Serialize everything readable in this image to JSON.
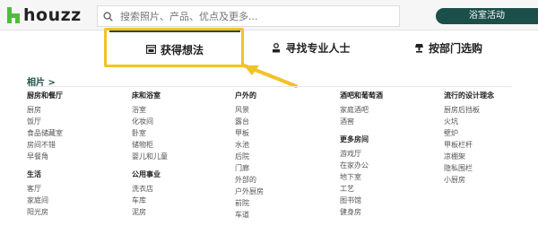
{
  "header": {
    "logo_text": "houzz",
    "search_placeholder": "搜索照片、产品、优点及更多...",
    "cta_label": "浴室活动"
  },
  "tabs": [
    {
      "label": "获得想法"
    },
    {
      "label": "寻找专业人士"
    },
    {
      "label": "按部门选购"
    }
  ],
  "section_title": "相片 >",
  "columns": [
    {
      "groups": [
        {
          "heading": "厨房和餐厅",
          "items": [
            "厨房",
            "饭厅",
            "食品储藏室",
            "房间不错",
            "早餐角"
          ]
        },
        {
          "heading": "生活",
          "items": [
            "客厅",
            "家庭间",
            "阳光房"
          ]
        }
      ]
    },
    {
      "groups": [
        {
          "heading": "床和浴室",
          "items": [
            "浴室",
            "化妆间",
            "卧室",
            "储物柜",
            "婴儿和儿童"
          ]
        },
        {
          "heading": "公用事业",
          "items": [
            "洗衣店",
            "车库",
            "泥房"
          ]
        }
      ]
    },
    {
      "groups": [
        {
          "heading": "户外的",
          "items": [
            "风景",
            "露台",
            "甲板",
            "水池",
            "后院",
            "门廊",
            "外部的",
            "户外厨房",
            "前院",
            "车道"
          ]
        }
      ]
    },
    {
      "groups": [
        {
          "heading": "酒吧和葡萄酒",
          "items": [
            "家庭酒吧",
            "酒窖"
          ]
        },
        {
          "heading": "更多房间",
          "items": [
            "游戏厅",
            "在家办公",
            "地下室",
            "工艺",
            "图书馆",
            "健身房"
          ]
        }
      ]
    },
    {
      "groups": [
        {
          "heading": "流行的设计理念",
          "items": [
            "厨房后挡板",
            "火坑",
            "壁炉",
            "甲板栏杆",
            "凉棚架",
            "隐私围栏",
            "小厨房"
          ]
        }
      ]
    }
  ],
  "colors": {
    "brand_green": "#4bbf3a",
    "dark_teal": "#1b4f4a",
    "highlight": "#f3c227"
  }
}
